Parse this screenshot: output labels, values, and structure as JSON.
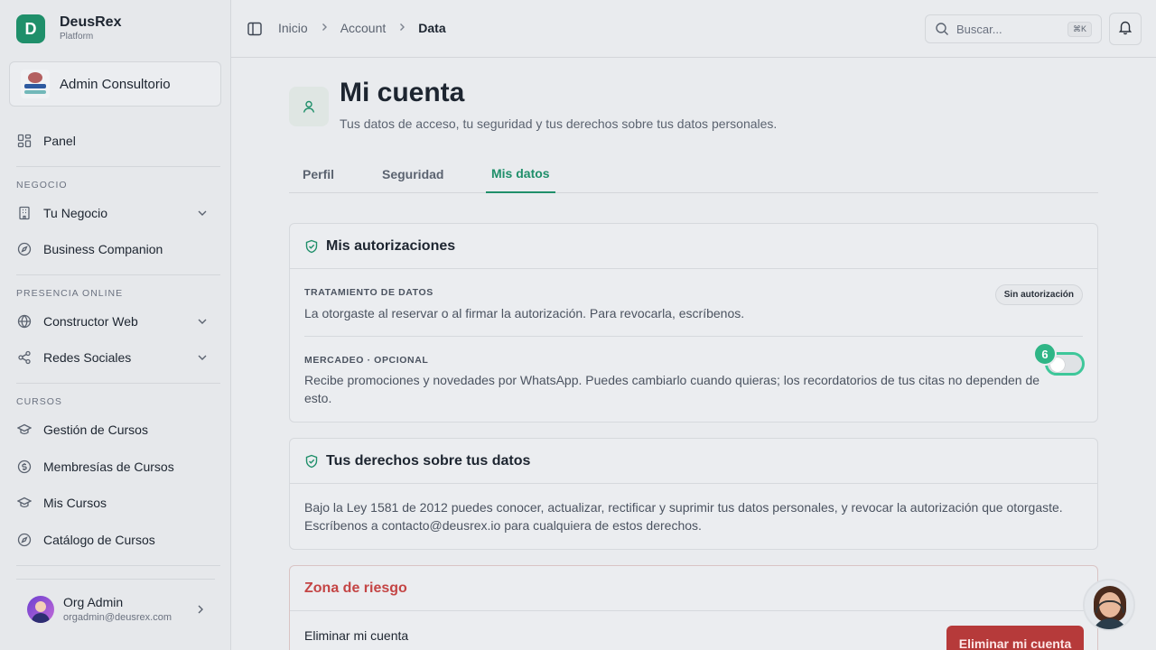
{
  "brand": {
    "name": "DeusRex",
    "subtitle": "Platform",
    "initial": "D"
  },
  "org": {
    "name": "Admin Consultorio"
  },
  "sidebar": {
    "panel": "Panel",
    "sections": {
      "negocio": "NEGOCIO",
      "presencia": "PRESENCIA ONLINE",
      "cursos": "CURSOS"
    },
    "items": {
      "tu_negocio": "Tu Negocio",
      "business_companion": "Business Companion",
      "constructor_web": "Constructor Web",
      "redes_sociales": "Redes Sociales",
      "gestion_cursos": "Gestión de Cursos",
      "membresias_cursos": "Membresías de Cursos",
      "mis_cursos": "Mis Cursos",
      "catalogo_cursos": "Catálogo de Cursos"
    }
  },
  "user": {
    "name": "Org Admin",
    "email": "orgadmin@deusrex.com"
  },
  "topbar": {
    "breadcrumb": [
      "Inicio",
      "Account",
      "Data"
    ],
    "search_placeholder": "Buscar...",
    "shortcut": "⌘K"
  },
  "page": {
    "title": "Mi cuenta",
    "subtitle": "Tus datos de acceso, tu seguridad y tus derechos sobre tus datos personales."
  },
  "tabs": [
    {
      "label": "Perfil",
      "active": false
    },
    {
      "label": "Seguridad",
      "active": false
    },
    {
      "label": "Mis datos",
      "active": true
    }
  ],
  "autorizaciones": {
    "title": "Mis autorizaciones",
    "tratamiento": {
      "label": "TRATAMIENTO DE DATOS",
      "text": "La otorgaste al reservar o al firmar la autorización. Para revocarla, escríbenos.",
      "badge": "Sin autorización"
    },
    "mercadeo": {
      "label": "MERCADEO · OPCIONAL",
      "text": "Recibe promociones y novedades por WhatsApp. Puedes cambiarlo cuando quieras; los recordatorios de tus citas no dependen de esto.",
      "enabled": false,
      "marker": "6"
    }
  },
  "derechos": {
    "title": "Tus derechos sobre tus datos",
    "text": "Bajo la Ley 1581 de 2012 puedes conocer, actualizar, rectificar y suprimir tus datos personales, y revocar la autorización que otorgaste. Escríbenos a contacto@deusrex.io para cualquiera de estos derechos."
  },
  "riesgo": {
    "title": "Zona de riesgo",
    "item_label": "Eliminar mi cuenta",
    "button": "Eliminar mi cuenta"
  },
  "colors": {
    "accent": "#1f8f6a",
    "danger": "#b63a3a",
    "toggle_ring": "#3ec79a"
  }
}
